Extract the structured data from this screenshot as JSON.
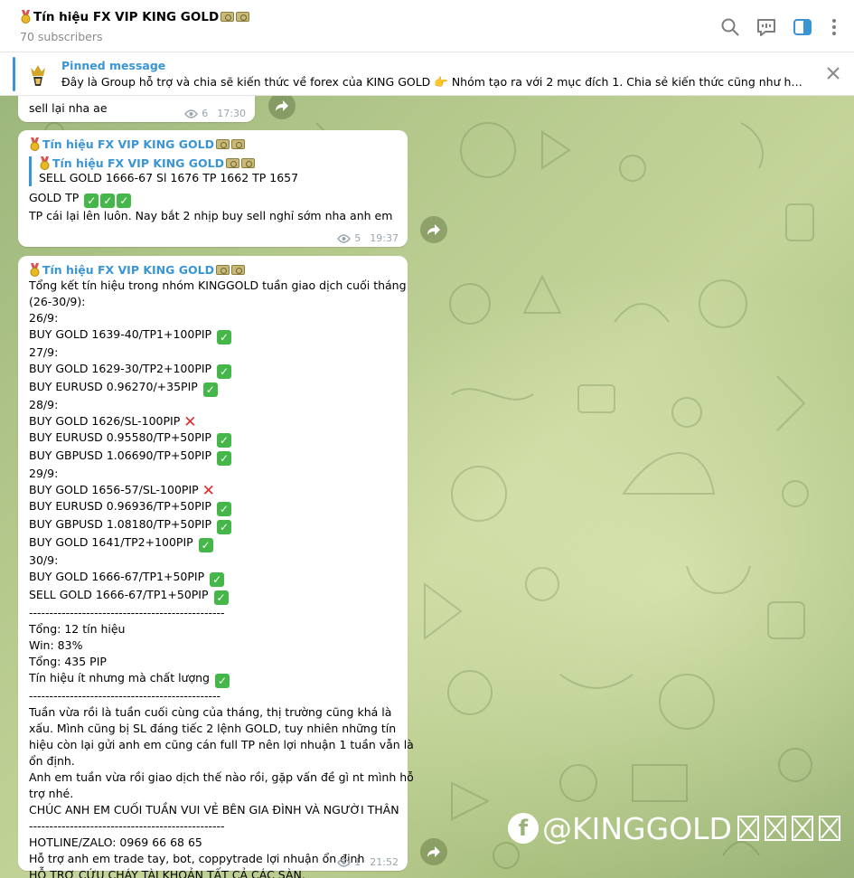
{
  "header": {
    "title": "Tín hiệu FX VIP KING GOLD",
    "subscribers": "70 subscribers",
    "icons": [
      "search-icon",
      "chat-icon",
      "sidebar-toggle-icon",
      "more-vertical-icon"
    ]
  },
  "pinned": {
    "title": "Pinned message",
    "text": "Đây là Group hỗ trợ và chia sẽ kiến thức về forex của KING GOLD  👉 Nhóm tạo ra với 2 mục đích  1. Chia sẻ kiến thức cũng như hỗ trợ p..."
  },
  "messages": [
    {
      "text": "sell lại nha ae",
      "views": "6",
      "time": "17:30"
    },
    {
      "sender": "Tín hiệu FX VIP KING GOLD",
      "reply_sender": "Tín hiệu FX VIP KING GOLD",
      "reply_text": "SELL GOLD 1666-67 Sl   1676 TP  1662 TP  1657",
      "line1": "GOLD TP",
      "line2": "TP cái lại lên luôn. Nay bắt 2 nhịp buy sell nghỉ sớm nha anh em",
      "views": "5",
      "time": "19:37"
    },
    {
      "sender": "Tín hiệu FX VIP KING GOLD",
      "lines": [
        {
          "t": "Tổng kết tín hiệu trong nhóm KINGGOLD tuần giao dịch cuối tháng",
          "m": ""
        },
        {
          "t": "(26-30/9):",
          "m": ""
        },
        {
          "t": "26/9:",
          "m": ""
        },
        {
          "t": "BUY GOLD  1639-40/TP1+100PIP",
          "m": "check"
        },
        {
          "t": "27/9:",
          "m": ""
        },
        {
          "t": "BUY GOLD 1629-30/TP2+100PIP",
          "m": "check"
        },
        {
          "t": "BUY EURUSD  0.96270/+35PIP",
          "m": "check"
        },
        {
          "t": "28/9:",
          "m": ""
        },
        {
          "t": "BUY GOLD 1626/SL-100PIP",
          "m": "cross"
        },
        {
          "t": "BUY EURUSD 0.95580/TP+50PIP",
          "m": "check"
        },
        {
          "t": "BUY GBPUSD   1.06690/TP+50PIP",
          "m": "check"
        },
        {
          "t": "29/9:",
          "m": ""
        },
        {
          "t": "BUY GOLD 1656-57/SL-100PIP",
          "m": "cross"
        },
        {
          "t": "BUY EURUSD  0.96936/TP+50PIP",
          "m": "check"
        },
        {
          "t": "BUY GBPUSD  1.08180/TP+50PIP",
          "m": "check"
        },
        {
          "t": "BUY GOLD 1641/TP2+100PIP",
          "m": "check"
        },
        {
          "t": "30/9:",
          "m": ""
        },
        {
          "t": "BUY GOLD 1666-67/TP1+50PIP",
          "m": "check"
        },
        {
          "t": "SELL GOLD 1666-67/TP1+50PIP",
          "m": "check"
        },
        {
          "t": "------------------------------------------------",
          "m": ""
        },
        {
          "t": "Tổng: 12 tín hiệu",
          "m": ""
        },
        {
          "t": "Win: 83%",
          "m": ""
        },
        {
          "t": "Tổng: 435 PIP",
          "m": ""
        },
        {
          "t": "Tín hiệu ít nhưng mà chất lượng",
          "m": "check"
        },
        {
          "t": "-----------------------------------------------",
          "m": ""
        },
        {
          "t": "Tuần vừa rồi là tuần cuối cùng của tháng, thị trường cũng khá là",
          "m": ""
        },
        {
          "t": "xấu. Mình cũng bị SL đáng tiếc 2 lệnh GOLD, tuy nhiên những tín",
          "m": ""
        },
        {
          "t": "hiệu còn lại gửi anh em cũng cán full TP nên lợi nhuận 1 tuần vẫn là",
          "m": ""
        },
        {
          "t": "ổn định.",
          "m": ""
        },
        {
          "t": "Anh em tuần vừa rồi giao dịch thế nào rồi, gặp vấn đề gì nt mình hỗ",
          "m": ""
        },
        {
          "t": "trợ nhé.",
          "m": ""
        },
        {
          "t": "CHÚC ANH EM CUỐI TUẦN VUI VẺ BÊN GIA ĐÌNH VÀ NGƯỜI THÂN",
          "m": ""
        },
        {
          "t": "------------------------------------------------",
          "m": ""
        },
        {
          "t": "HOTLINE/ZALO: 0969 66 68 65",
          "m": ""
        },
        {
          "t": "Hỗ trợ anh em trade tay, bot, coppytrade lợi nhuận ổn định",
          "m": ""
        },
        {
          "t": "HỖ TRỢ CỨU CHÁY TÀI KHOẢN TẤT CẢ CÁC SÀN.",
          "m": ""
        }
      ],
      "views": "1",
      "time": "21:52"
    }
  ],
  "watermark": {
    "logo_letter": "f",
    "text": "@KINGGOLD"
  },
  "colors": {
    "accent": "#3a95d5",
    "check": "#45b649",
    "cross": "#e02a2a"
  }
}
